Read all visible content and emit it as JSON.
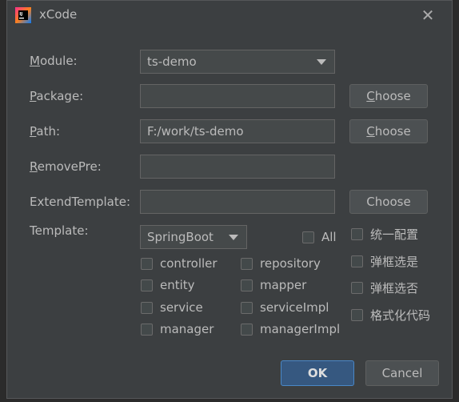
{
  "window": {
    "title": "xCode",
    "icon": "intellij-icon",
    "close_icon": "close-icon"
  },
  "form": {
    "module": {
      "label_mnemonic": "M",
      "label_rest": "odule:",
      "value": "ts-demo"
    },
    "package": {
      "label_mnemonic": "P",
      "label_rest": "ackage:",
      "value": "",
      "button": "Choose"
    },
    "path": {
      "label_mnemonic": "P",
      "label_rest": "ath:",
      "value": "F:/work/ts-demo",
      "button": "Choose"
    },
    "remove_pre": {
      "label_mnemonic": "R",
      "label_rest": "emovePre:",
      "value": ""
    },
    "extend_template": {
      "label": "ExtendTemplate:",
      "value": "",
      "button": "Choose"
    },
    "template": {
      "label": "Template:",
      "value": "SpringBoot"
    }
  },
  "checkboxes": {
    "all": "All",
    "col1": [
      "controller",
      "entity",
      "service",
      "manager"
    ],
    "col2": [
      "repository",
      "mapper",
      "serviceImpl",
      "managerImpl"
    ],
    "col3": [
      "统一配置",
      "弹框选是",
      "弹框选否",
      "格式化代码"
    ]
  },
  "footer": {
    "ok": "OK",
    "cancel": "Cancel"
  },
  "colors": {
    "background": "#3c3f41",
    "ok_button": "#365880",
    "text": "#bbbbbb"
  }
}
